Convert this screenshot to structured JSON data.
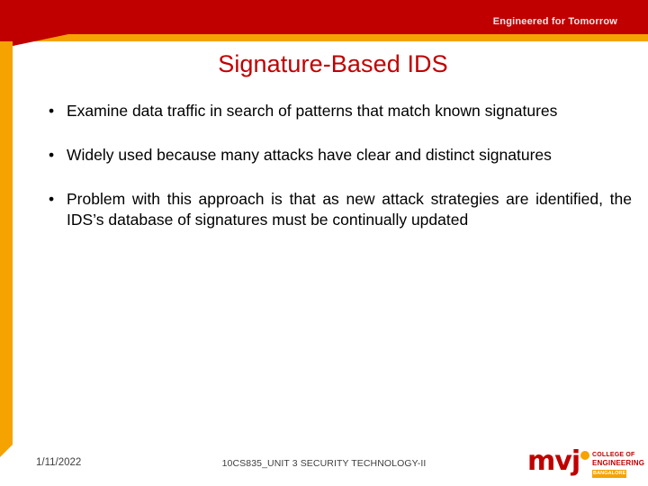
{
  "banner": {
    "tagline": "Engineered for Tomorrow",
    "red": "#C00000",
    "orange": "#F5A300"
  },
  "slide": {
    "title": "Signature-Based IDS",
    "bullets": [
      "Examine data traffic in search of patterns that match known signatures",
      "Widely used because many attacks have clear and distinct signatures",
      "Problem with this approach is that as new attack strategies are identified, the IDS’s database of signatures must be continually updated"
    ],
    "bullet_marker": "•"
  },
  "footer": {
    "date": "1/11/2022",
    "center_text": "10CS835_UNIT 3 SECURITY TECHNOLOGY-II"
  },
  "logo": {
    "wordmark": "mvj",
    "line1": "COLLEGE OF",
    "line2": "ENGINEERING",
    "line3": "BANGALORE"
  }
}
